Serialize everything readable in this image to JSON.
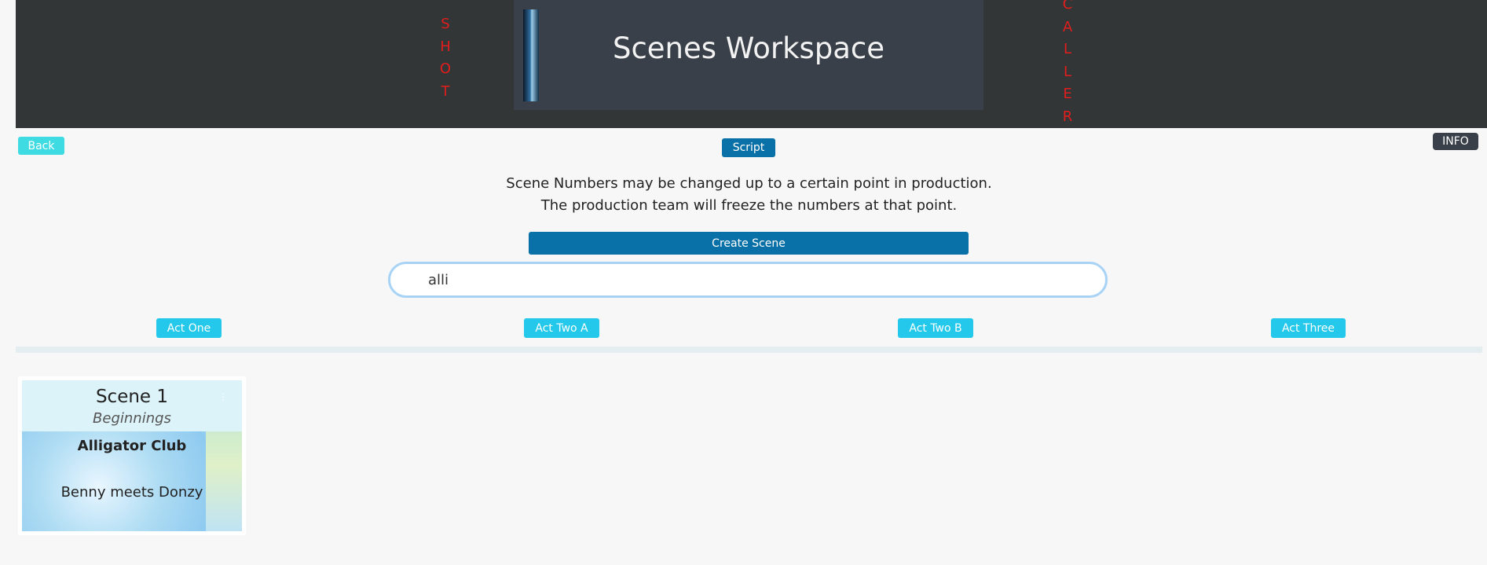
{
  "header": {
    "left_vertical": [
      "S",
      "H",
      "O",
      "T"
    ],
    "right_vertical": [
      "C",
      "A",
      "L",
      "L",
      "E",
      "R"
    ],
    "title": "Scenes Workspace"
  },
  "nav": {
    "back_label": "Back",
    "script_label": "Script",
    "info_label": "INFO"
  },
  "notice": {
    "line1": "Scene Numbers may be changed up to a certain point in production.",
    "line2": "The production team will freeze the numbers at that point."
  },
  "actions": {
    "create_label": "Create Scene"
  },
  "search": {
    "value": "alli"
  },
  "acts": [
    {
      "label": "Act One"
    },
    {
      "label": "Act Two A"
    },
    {
      "label": "Act Two B"
    },
    {
      "label": "Act Three"
    }
  ],
  "scenes": [
    {
      "number": "Scene 1",
      "subtitle": "Beginnings",
      "location": "Alligator Club",
      "description": "Benny meets Donzy"
    }
  ],
  "colors": {
    "accent": "#0a71a8",
    "act_button": "#23c8eb",
    "back_button": "#3fdbe2",
    "brand_red": "#e11d1d"
  }
}
